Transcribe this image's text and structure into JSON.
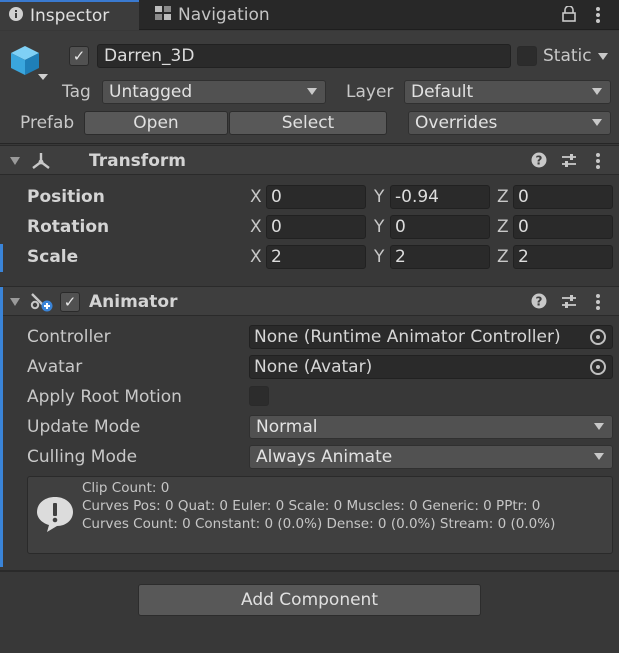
{
  "tabs": {
    "inspector": "Inspector",
    "navigation": "Navigation"
  },
  "gameobject": {
    "active": true,
    "name": "Darren_3D",
    "static_label": "Static",
    "static_checked": false,
    "tag_label": "Tag",
    "tag_value": "Untagged",
    "layer_label": "Layer",
    "layer_value": "Default",
    "prefab_label": "Prefab",
    "prefab_open": "Open",
    "prefab_select": "Select",
    "prefab_overrides": "Overrides"
  },
  "transform": {
    "title": "Transform",
    "position_label": "Position",
    "rotation_label": "Rotation",
    "scale_label": "Scale",
    "axis_x": "X",
    "axis_y": "Y",
    "axis_z": "Z",
    "position": {
      "x": "0",
      "y": "-0.94",
      "z": "0"
    },
    "rotation": {
      "x": "0",
      "y": "0",
      "z": "0"
    },
    "scale": {
      "x": "2",
      "y": "2",
      "z": "2"
    }
  },
  "animator": {
    "title": "Animator",
    "enabled": true,
    "controller_label": "Controller",
    "controller_value": "None (Runtime Animator Controller)",
    "avatar_label": "Avatar",
    "avatar_value": "None (Avatar)",
    "root_motion_label": "Apply Root Motion",
    "root_motion_checked": false,
    "update_mode_label": "Update Mode",
    "update_mode_value": "Normal",
    "culling_mode_label": "Culling Mode",
    "culling_mode_value": "Always Animate",
    "info_line1": "Clip Count: 0",
    "info_line2": "Curves Pos: 0 Quat: 0 Euler: 0 Scale: 0 Muscles: 0 Generic: 0 PPtr: 0",
    "info_line3": "Curves Count: 0 Constant: 0 (0.0%) Dense: 0 (0.0%) Stream: 0 (0.0%)"
  },
  "footer": {
    "add_component": "Add Component"
  },
  "icons": {
    "inspector_tab": "info-icon",
    "navigation_tab": "navigation-icon",
    "lock": "lock-icon",
    "menu": "kebab-menu-icon",
    "gameobject": "cube-icon",
    "transform": "transform-axes-icon",
    "animator": "animator-icon",
    "help": "help-icon",
    "presets": "presets-icon",
    "object_picker": "object-picker-icon",
    "warning": "warning-speech-icon"
  },
  "colors": {
    "accent_blue": "#3a84d8",
    "background": "#383838"
  }
}
